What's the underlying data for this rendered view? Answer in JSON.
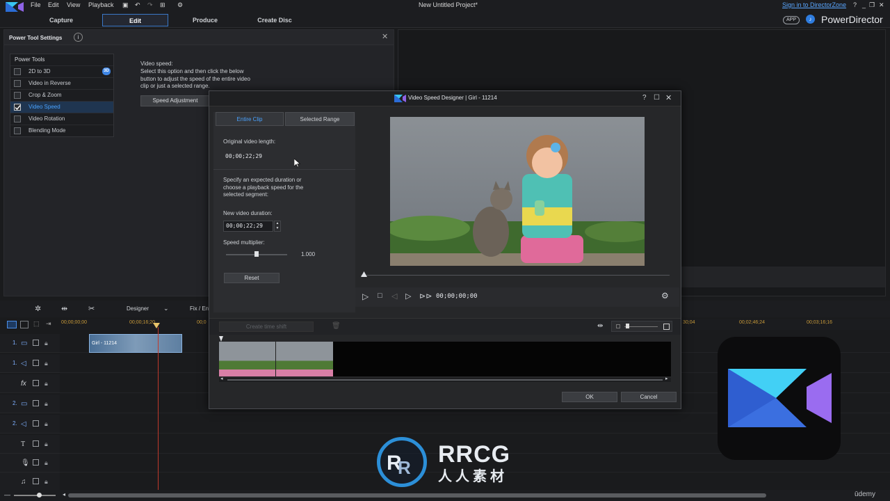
{
  "menubar": {
    "items": [
      "File",
      "Edit",
      "View",
      "Playback"
    ],
    "project_title": "New Untitled Project*",
    "sign_in": "Sign in to DirectorZone",
    "help": "?",
    "app_badge": "APP",
    "brand": "PowerDirector"
  },
  "modes": {
    "tabs": [
      "Capture",
      "Edit",
      "Produce",
      "Create Disc"
    ],
    "active": "Edit"
  },
  "power_tool_panel": {
    "title": "Power Tool Settings",
    "list_header": "Power Tools",
    "items": [
      {
        "label": "2D to 3D",
        "checked": false,
        "badge": "3D"
      },
      {
        "label": "Video in Reverse",
        "checked": false
      },
      {
        "label": "Crop & Zoom",
        "checked": false
      },
      {
        "label": "Video Speed",
        "checked": true,
        "selected": true
      },
      {
        "label": "Video Rotation",
        "checked": false
      },
      {
        "label": "Blending Mode",
        "checked": false
      }
    ],
    "description_title": "Video speed:",
    "description": [
      "Select this option and then click the below",
      "button to adjust the speed of the entire video",
      "clip or just a selected range."
    ],
    "speed_button": "Speed Adjustment"
  },
  "dialog": {
    "title": "Video Speed Designer | Girl - 11214",
    "tabs": [
      "Entire Clip",
      "Selected Range"
    ],
    "active_tab": "Entire Clip",
    "original_length_label": "Original video length:",
    "original_length": "00;00;22;29",
    "instruction": [
      "Specify an expected duration or",
      "choose a playback speed for the",
      "selected segment:"
    ],
    "new_duration_label": "New video duration:",
    "new_duration": "00;00;22;29",
    "speed_label": "Speed multiplier:",
    "speed_value": "1.000",
    "speed_slider_fraction": 0.5,
    "reset": "Reset",
    "timecode": "00;00;00;00",
    "create_shift": "Create time shift",
    "ok": "OK",
    "cancel": "Cancel"
  },
  "timeline": {
    "mode": "Designer",
    "fix": "Fix / En",
    "ruler": [
      "00;00;00;00",
      "00;00;16;20",
      "00;0",
      "30;04",
      "00;02;46;24",
      "00;03;16;16"
    ],
    "clip_label": "Girl - 11214",
    "tracks": [
      {
        "num": "1.",
        "icon": "video-track-icon"
      },
      {
        "num": "1.",
        "icon": "audio-track-icon"
      },
      {
        "num": "",
        "icon": "fx-track-icon",
        "label": "fx"
      },
      {
        "num": "2.",
        "icon": "video-track-icon"
      },
      {
        "num": "2.",
        "icon": "audio-track-icon"
      },
      {
        "num": "",
        "icon": "title-track-icon",
        "label": "T"
      },
      {
        "num": "",
        "icon": "voice-track-icon"
      },
      {
        "num": "",
        "icon": "music-track-icon"
      }
    ]
  },
  "watermark": {
    "brand": "RRCG",
    "sub": "人人素材",
    "udemy": "ūdemy"
  },
  "colors": {
    "accent": "#4aa3ff",
    "selected_row": "#1f3550",
    "playhead": "#c0392b"
  }
}
